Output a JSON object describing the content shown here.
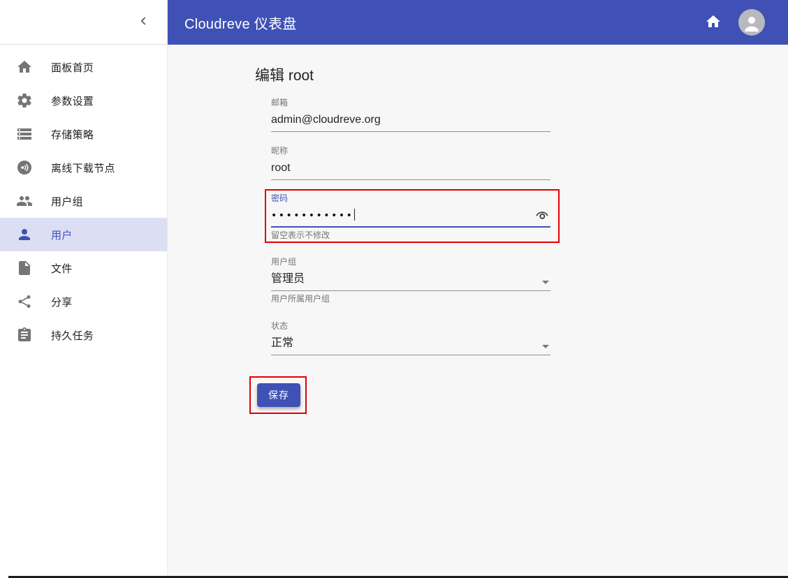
{
  "appbar": {
    "title": "Cloudreve 仪表盘"
  },
  "sidebar": {
    "items": [
      {
        "label": "面板首页",
        "icon": "home-icon",
        "selected": false
      },
      {
        "label": "参数设置",
        "icon": "gear-icon",
        "selected": false
      },
      {
        "label": "存储策略",
        "icon": "storage-icon",
        "selected": false
      },
      {
        "label": "离线下载节点",
        "icon": "broadcast-icon",
        "selected": false
      },
      {
        "label": "用户组",
        "icon": "people-icon",
        "selected": false
      },
      {
        "label": "用户",
        "icon": "person-icon",
        "selected": true
      },
      {
        "label": "文件",
        "icon": "file-icon",
        "selected": false
      },
      {
        "label": "分享",
        "icon": "share-icon",
        "selected": false
      },
      {
        "label": "持久任务",
        "icon": "clipboard-icon",
        "selected": false
      }
    ]
  },
  "main": {
    "heading": "编辑 root",
    "fields": {
      "email": {
        "label": "邮箱",
        "value": "admin@cloudreve.org"
      },
      "nickname": {
        "label": "昵称",
        "value": "root"
      },
      "password": {
        "label": "密码",
        "value_masked": "•••••••••••",
        "helper": "留空表示不修改",
        "focused": true
      },
      "group": {
        "label": "用户组",
        "value": "管理员",
        "helper": "用户所属用户组"
      },
      "status": {
        "label": "状态",
        "value": "正常"
      }
    },
    "save_button_label": "保存"
  },
  "colors": {
    "primary": "#3f51b5",
    "selected_item_bg": "#dcdef3",
    "annotation_red": "#e10000",
    "main_bg": "#f7f7f7"
  }
}
